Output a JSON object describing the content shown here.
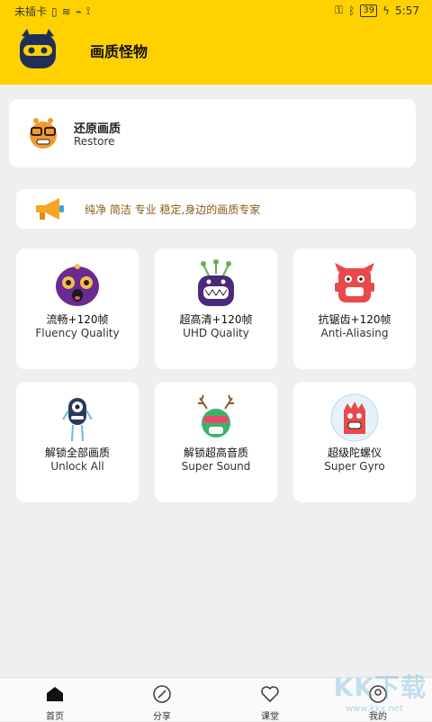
{
  "status_bar": {
    "left_text": "未插卡",
    "time": "5:57",
    "battery": "39"
  },
  "header": {
    "title": "画质怪物"
  },
  "restore_card": {
    "title": "还原画质",
    "subtitle": "Restore"
  },
  "notice": {
    "text": "纯净 简洁 专业 稳定,身边的画质专家"
  },
  "tiles": [
    {
      "title": "流畅+120帧",
      "subtitle": "Fluency Quality",
      "icon": "purple-monster-icon"
    },
    {
      "title": "超高清+120帧",
      "subtitle": "UHD Quality",
      "icon": "antenna-monster-icon"
    },
    {
      "title": "抗锯齿+120帧",
      "subtitle": "Anti-Aliasing",
      "icon": "red-monster-icon"
    },
    {
      "title": "解锁全部画质",
      "subtitle": "Unlock All",
      "icon": "one-eye-monster-icon"
    },
    {
      "title": "解锁超高音质",
      "subtitle": "Super Sound",
      "icon": "antler-monster-icon"
    },
    {
      "title": "超级陀螺仪",
      "subtitle": "Super Gyro",
      "icon": "bubble-monster-icon"
    }
  ],
  "bottom_nav": [
    {
      "label": "首页",
      "icon": "home-icon"
    },
    {
      "label": "分享",
      "icon": "compass-icon"
    },
    {
      "label": "课堂",
      "icon": "heart-icon"
    },
    {
      "label": "我的",
      "icon": "profile-icon"
    }
  ],
  "watermark": {
    "text": "KK下载",
    "small": "www.kkx.net"
  },
  "colors": {
    "header_bg": "#ffd100",
    "page_bg": "#efefef",
    "notice_text": "#8a5a14"
  }
}
